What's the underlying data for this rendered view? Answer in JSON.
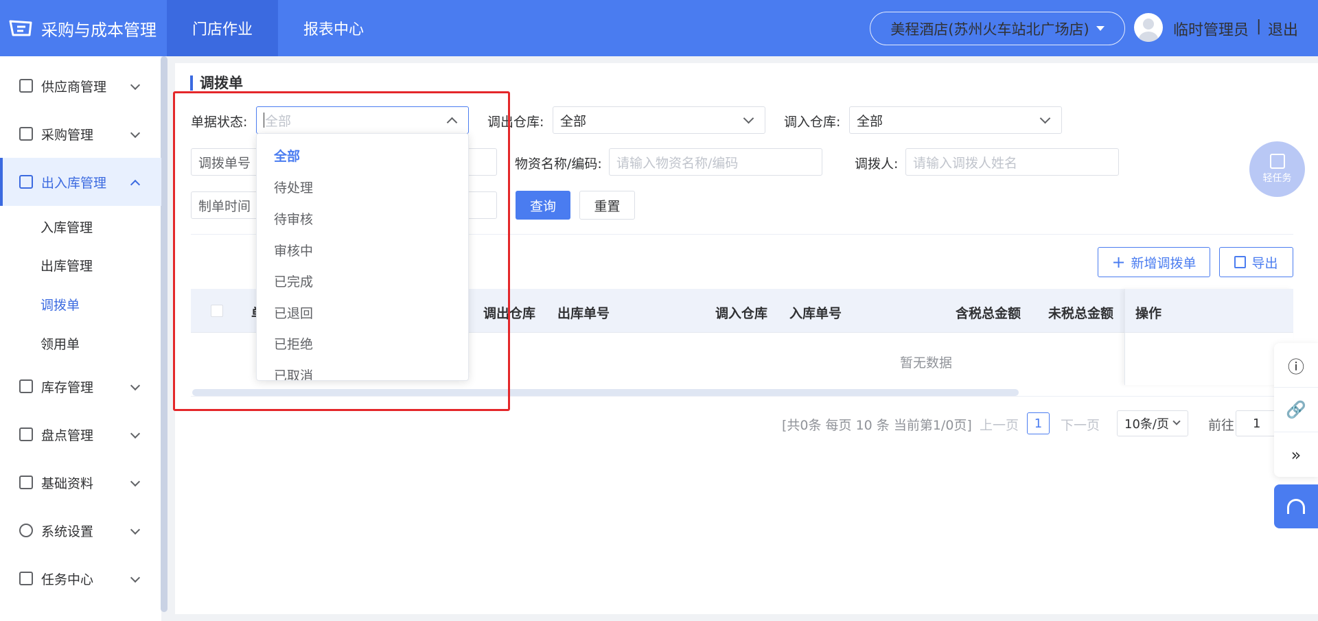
{
  "app": {
    "title": "采购与成本管理"
  },
  "topnav": [
    {
      "label": "门店作业",
      "active": true
    },
    {
      "label": "报表中心",
      "active": false
    }
  ],
  "store": {
    "name": "美程酒店(苏州火车站北广场店)"
  },
  "user": {
    "name": "临时管理员",
    "separator": "|",
    "logout": "退出"
  },
  "sidebar": {
    "items": [
      {
        "label": "供应商管理"
      },
      {
        "label": "采购管理"
      },
      {
        "label": "出入库管理"
      },
      {
        "label": "库存管理"
      },
      {
        "label": "盘点管理"
      },
      {
        "label": "基础资料"
      },
      {
        "label": "系统设置"
      },
      {
        "label": "任务中心"
      }
    ],
    "subitems": [
      {
        "label": "入库管理"
      },
      {
        "label": "出库管理"
      },
      {
        "label": "调拨单"
      },
      {
        "label": "领用单"
      }
    ]
  },
  "page": {
    "title": "调拨单"
  },
  "filters": {
    "status_label": "单据状态:",
    "status_placeholder": "全部",
    "out_wh_label": "调出仓库:",
    "out_wh_value": "全部",
    "in_wh_label": "调入仓库:",
    "in_wh_value": "全部",
    "order_no_label": "调拨单号",
    "material_label": "物资名称/编码:",
    "material_placeholder": "请输入物资名称/编码",
    "transferor_label": "调拨人:",
    "transferor_placeholder": "请输入调拨人姓名",
    "date_label": "制单时间",
    "query": "查询",
    "reset": "重置"
  },
  "actions": {
    "add": "新增调拨单",
    "export": "导出"
  },
  "table": {
    "columns": [
      "单",
      "调出仓库",
      "出库单号",
      "调入仓库",
      "入库单号",
      "含税总金额",
      "未税总金额",
      "操作"
    ],
    "empty": "暂无数据"
  },
  "pagination": {
    "summary": "[共0条 每页 10 条 当前第1/0页]",
    "prev": "上一页",
    "current": "1",
    "next": "下一页",
    "size": "10条/页",
    "goto_label": "前往",
    "goto_value": "1"
  },
  "dropdown": {
    "options": [
      "全部",
      "待处理",
      "待审核",
      "审核中",
      "已完成",
      "已退回",
      "已拒绝",
      "已取消"
    ],
    "selected": "全部"
  },
  "float_task": {
    "label": "轻任务"
  },
  "colors": {
    "primary": "#4a7cf0",
    "highlight": "#e4272a",
    "sidebar_active_bg": "#e8f0fe"
  }
}
